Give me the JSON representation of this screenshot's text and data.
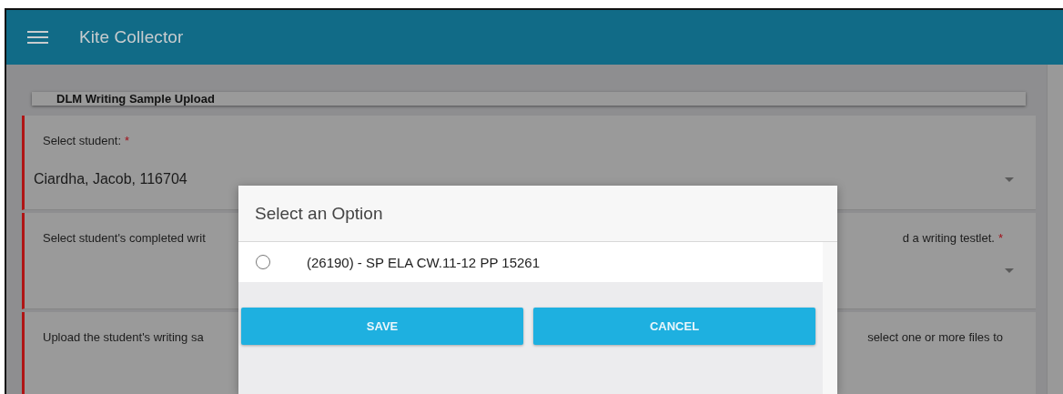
{
  "app": {
    "title": "Kite Collector"
  },
  "page_title": "DLM Writing Sample Upload",
  "fields": [
    {
      "kind": "select",
      "label_parts": [
        "Select student:"
      ],
      "required_mark": "*",
      "value": "Ciardha, Jacob, 116704"
    },
    {
      "kind": "select",
      "label_parts": [
        "Select student's completed writ",
        "d a writing testlet."
      ],
      "required_mark": "*"
    },
    {
      "kind": "upload",
      "label_parts": [
        "Upload the student's writing sa",
        "select one or more files to"
      ]
    }
  ],
  "dialog": {
    "title": "Select an Option",
    "options": [
      {
        "label": "(26190) - SP ELA CW.11-12 PP 15261",
        "selected": false
      }
    ],
    "buttons": [
      {
        "label": "SAVE"
      },
      {
        "label": "CANCEL"
      }
    ]
  }
}
